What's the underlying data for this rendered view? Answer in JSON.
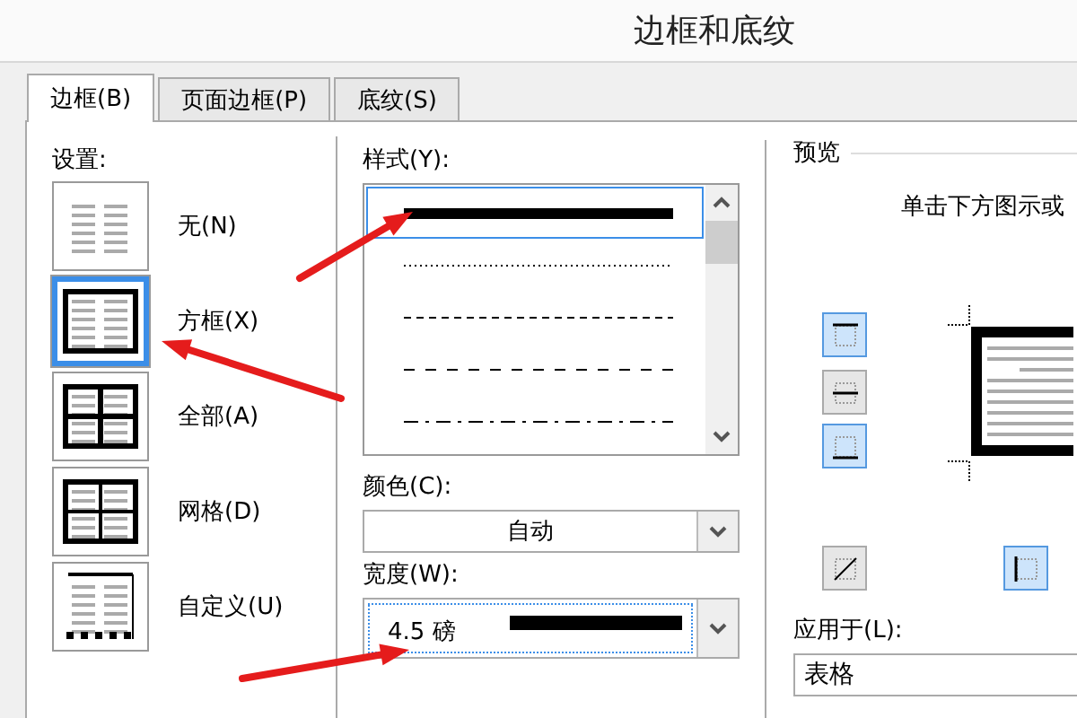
{
  "window": {
    "title": "边框和底纹"
  },
  "tabs": [
    {
      "label": "边框(B)",
      "selected": true
    },
    {
      "label": "页面边框(P)",
      "selected": false
    },
    {
      "label": "底纹(S)",
      "selected": false
    }
  ],
  "settings": {
    "label": "设置:",
    "items": [
      {
        "kind": "none",
        "label": "无(N)",
        "selected": false
      },
      {
        "kind": "box",
        "label": "方框(X)",
        "selected": true
      },
      {
        "kind": "all",
        "label": "全部(A)",
        "selected": false
      },
      {
        "kind": "grid",
        "label": "网格(D)",
        "selected": false
      },
      {
        "kind": "custom",
        "label": "自定义(U)",
        "selected": false
      }
    ]
  },
  "style": {
    "label": "样式(Y):",
    "items": [
      {
        "kind": "thick",
        "selected": true
      },
      {
        "kind": "dotted",
        "selected": false
      },
      {
        "kind": "dashed",
        "selected": false
      },
      {
        "kind": "longdash",
        "selected": false
      },
      {
        "kind": "dashdot",
        "selected": false
      }
    ]
  },
  "color": {
    "label": "颜色(C):",
    "value": "自动"
  },
  "width": {
    "label": "宽度(W):",
    "value": "4.5 磅"
  },
  "preview": {
    "label": "预览",
    "hint": "单击下方图示或",
    "buttons": [
      {
        "kind": "top",
        "selected": true
      },
      {
        "kind": "middle",
        "selected": false
      },
      {
        "kind": "bottom",
        "selected": true
      },
      {
        "kind": "diagonal",
        "selected": false
      },
      {
        "kind": "left",
        "selected": true
      }
    ]
  },
  "apply_to": {
    "label": "应用于(L):",
    "value": "表格"
  },
  "annotations": [
    {
      "kind": "arrow"
    },
    {
      "kind": "arrow"
    },
    {
      "kind": "arrow"
    }
  ]
}
